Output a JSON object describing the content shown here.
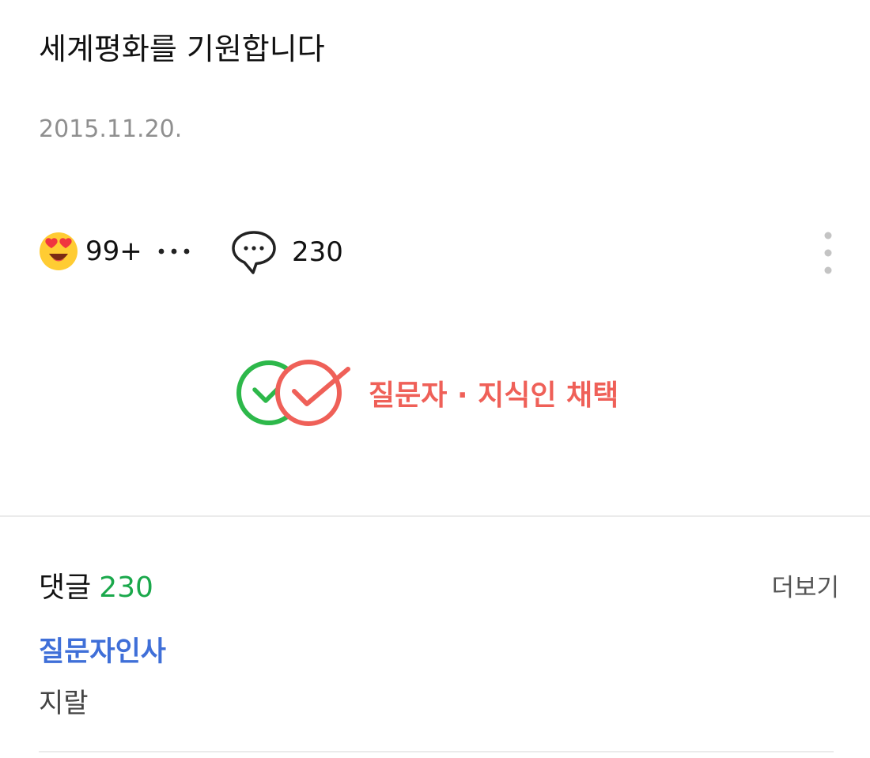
{
  "post": {
    "title": "세계평화를 기원합니다",
    "date": "2015.11.20."
  },
  "reactions": {
    "emoji_icon": "heart-eyes-emoji-icon",
    "count": "99+",
    "more_icon": "more-horizontal-icon",
    "comment_icon": "speech-bubble-icon",
    "comment_count": "230",
    "options_icon": "more-vertical-icon"
  },
  "badge": {
    "icon": "double-check-circle-icon",
    "label": "질문자 · 지식인 채택",
    "colors": {
      "green": "#2db84a",
      "red": "#ef6058"
    }
  },
  "comments": {
    "label": "댓글",
    "count": "230",
    "count_color": "#1aa84b",
    "see_more": "더보기",
    "items": [
      {
        "author": "질문자인사",
        "author_color": "#3f6fd8",
        "text": "지랄"
      }
    ]
  }
}
